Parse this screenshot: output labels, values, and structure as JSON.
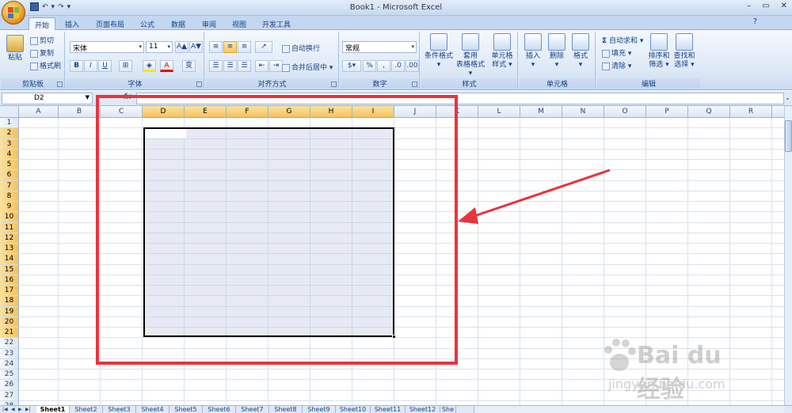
{
  "window": {
    "title": "Book1 - Microsoft Excel",
    "minimize": "–",
    "restore": "▭",
    "close": "✕",
    "help": "?"
  },
  "qat": {
    "undo": "↶",
    "redo": "↷",
    "more": "▾"
  },
  "tabs": [
    "开始",
    "插入",
    "页面布局",
    "公式",
    "数据",
    "审阅",
    "视图",
    "开发工具"
  ],
  "ribbon": {
    "clipboard": {
      "label": "剪贴板",
      "paste": "粘贴",
      "cut": "剪切",
      "copy": "复制",
      "format_painter": "格式刷"
    },
    "font": {
      "label": "字体",
      "name": "宋体",
      "size": "11",
      "grow": "A▲",
      "shrink": "A▼",
      "bold": "B",
      "italic": "I",
      "underline": "U",
      "wen": "变"
    },
    "align": {
      "label": "对齐方式",
      "wrap": "自动换行",
      "merge": "合并后居中"
    },
    "number": {
      "label": "数字",
      "format": "常规",
      "percent": "%",
      "comma": ","
    },
    "styles": {
      "label": "样式",
      "cond": "条件格式",
      "table1": "套用",
      "table2": "表格格式",
      "cell1": "单元格",
      "cell2": "样式"
    },
    "cells": {
      "label": "单元格",
      "insert": "插入",
      "delete": "删除",
      "format": "格式"
    },
    "edit": {
      "label": "编辑",
      "sum": "自动求和",
      "fill": "填充",
      "clear": "清除",
      "sort1": "排序和",
      "sort2": "筛选",
      "find1": "查找和",
      "find2": "选择"
    }
  },
  "formula_bar": {
    "name_box": "D2",
    "fx": "fx",
    "content": ""
  },
  "columns": [
    "A",
    "B",
    "C",
    "D",
    "E",
    "F",
    "G",
    "H",
    "I",
    "J",
    "K",
    "L",
    "M",
    "N",
    "O",
    "P",
    "Q",
    "R",
    "S"
  ],
  "selected_columns": [
    "D",
    "E",
    "F",
    "G",
    "H",
    "I"
  ],
  "rows": [
    "1",
    "2",
    "3",
    "4",
    "5",
    "6",
    "7",
    "8",
    "9",
    "10",
    "11",
    "12",
    "13",
    "14",
    "15",
    "16",
    "17",
    "18",
    "19",
    "20",
    "21",
    "22",
    "23",
    "24",
    "25",
    "26",
    "27",
    "28"
  ],
  "selected_rows_range": [
    2,
    21
  ],
  "active_cell": "D2",
  "sheets": [
    "Sheet1",
    "Sheet2",
    "Sheet3",
    "Sheet4",
    "Sheet5",
    "Sheet6",
    "Sheet7",
    "Sheet8",
    "Sheet9",
    "Sheet10",
    "Sheet11",
    "Sheet12",
    "She"
  ],
  "active_sheet": "Sheet1",
  "watermark": {
    "brand": "Bai du 经验",
    "url": "jingyan.baidu.com"
  },
  "colors": {
    "annotation": "#e8343c",
    "selection_header": "#f6c25d",
    "ribbon_text": "#15428b"
  }
}
